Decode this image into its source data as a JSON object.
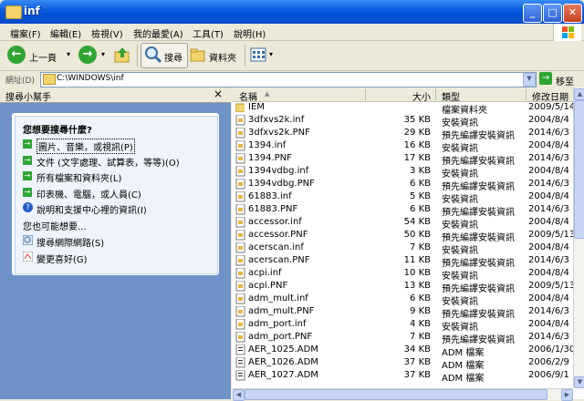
{
  "window": {
    "title": "inf",
    "minimize": "_",
    "maximize": "□",
    "close": "✕"
  },
  "menu": [
    "檔案(F)",
    "編輯(E)",
    "檢視(V)",
    "我的最愛(A)",
    "工具(T)",
    "說明(H)"
  ],
  "toolbar": {
    "back": "上一頁",
    "search": "搜尋",
    "folders": "資料夾"
  },
  "address": {
    "label": "網址(D)",
    "value": "C:\\WINDOWS\\inf",
    "go": "移至"
  },
  "left": {
    "header": "搜尋小幫手",
    "close": "×",
    "question": "您想要搜尋什麼?",
    "options": [
      "圖片、音樂，或視訊(P)",
      "文件 (文字處理、試算表，等等)(O)",
      "所有檔案和資料夾(L)",
      "印表機、電腦，或人員(C)",
      "說明和支援中心裡的資訊(I)"
    ],
    "maybe": "您也可能想要...",
    "extras": [
      "搜尋網際網路(S)",
      "變更喜好(G)"
    ]
  },
  "columns": {
    "name": "名稱",
    "size": "大小",
    "type": "類型",
    "modified": "修改日期"
  },
  "files": [
    {
      "name": "IEM",
      "size": "",
      "type": "檔案資料夾",
      "date": "2009/5/14",
      "kind": "folder"
    },
    {
      "name": "3dfxvs2k.inf",
      "size": "35 KB",
      "type": "安裝資訊",
      "date": "2004/8/4",
      "kind": "inf"
    },
    {
      "name": "3dfxvs2k.PNF",
      "size": "29 KB",
      "type": "預先編譯安裝資訊",
      "date": "2014/6/3",
      "kind": "pnf"
    },
    {
      "name": "1394.inf",
      "size": "16 KB",
      "type": "安裝資訊",
      "date": "2004/8/4",
      "kind": "inf"
    },
    {
      "name": "1394.PNF",
      "size": "17 KB",
      "type": "預先編譯安裝資訊",
      "date": "2014/6/3",
      "kind": "pnf"
    },
    {
      "name": "1394vdbg.inf",
      "size": "3 KB",
      "type": "安裝資訊",
      "date": "2004/8/4",
      "kind": "inf"
    },
    {
      "name": "1394vdbg.PNF",
      "size": "6 KB",
      "type": "預先編譯安裝資訊",
      "date": "2014/6/3",
      "kind": "pnf"
    },
    {
      "name": "61883.inf",
      "size": "5 KB",
      "type": "安裝資訊",
      "date": "2004/8/4",
      "kind": "inf"
    },
    {
      "name": "61883.PNF",
      "size": "6 KB",
      "type": "預先編譯安裝資訊",
      "date": "2014/6/3",
      "kind": "pnf"
    },
    {
      "name": "accessor.inf",
      "size": "54 KB",
      "type": "安裝資訊",
      "date": "2004/8/4",
      "kind": "inf"
    },
    {
      "name": "accessor.PNF",
      "size": "50 KB",
      "type": "預先編譯安裝資訊",
      "date": "2009/5/13",
      "kind": "pnf"
    },
    {
      "name": "acerscan.inf",
      "size": "7 KB",
      "type": "安裝資訊",
      "date": "2004/8/4",
      "kind": "inf"
    },
    {
      "name": "acerscan.PNF",
      "size": "11 KB",
      "type": "預先編譯安裝資訊",
      "date": "2014/6/3",
      "kind": "pnf"
    },
    {
      "name": "acpi.inf",
      "size": "10 KB",
      "type": "安裝資訊",
      "date": "2004/8/4",
      "kind": "inf"
    },
    {
      "name": "acpi.PNF",
      "size": "13 KB",
      "type": "預先編譯安裝資訊",
      "date": "2009/5/13",
      "kind": "pnf"
    },
    {
      "name": "adm_mult.inf",
      "size": "6 KB",
      "type": "安裝資訊",
      "date": "2004/8/4",
      "kind": "inf"
    },
    {
      "name": "adm_mult.PNF",
      "size": "9 KB",
      "type": "預先編譯安裝資訊",
      "date": "2014/6/3",
      "kind": "pnf"
    },
    {
      "name": "adm_port.inf",
      "size": "4 KB",
      "type": "安裝資訊",
      "date": "2004/8/4",
      "kind": "inf"
    },
    {
      "name": "adm_port.PNF",
      "size": "7 KB",
      "type": "預先編譯安裝資訊",
      "date": "2014/6/3",
      "kind": "pnf"
    },
    {
      "name": "AER_1025.ADM",
      "size": "34 KB",
      "type": "ADM 檔案",
      "date": "2006/1/30",
      "kind": "adm"
    },
    {
      "name": "AER_1026.ADM",
      "size": "37 KB",
      "type": "ADM 檔案",
      "date": "2006/2/9",
      "kind": "adm"
    },
    {
      "name": "AER_1027.ADM",
      "size": "37 KB",
      "type": "ADM 檔案",
      "date": "2006/9/1",
      "kind": "adm"
    }
  ],
  "colors": {
    "titlebar": "#0a5fe0",
    "leftpane": "#6f92c8",
    "link": "#215dc6"
  }
}
